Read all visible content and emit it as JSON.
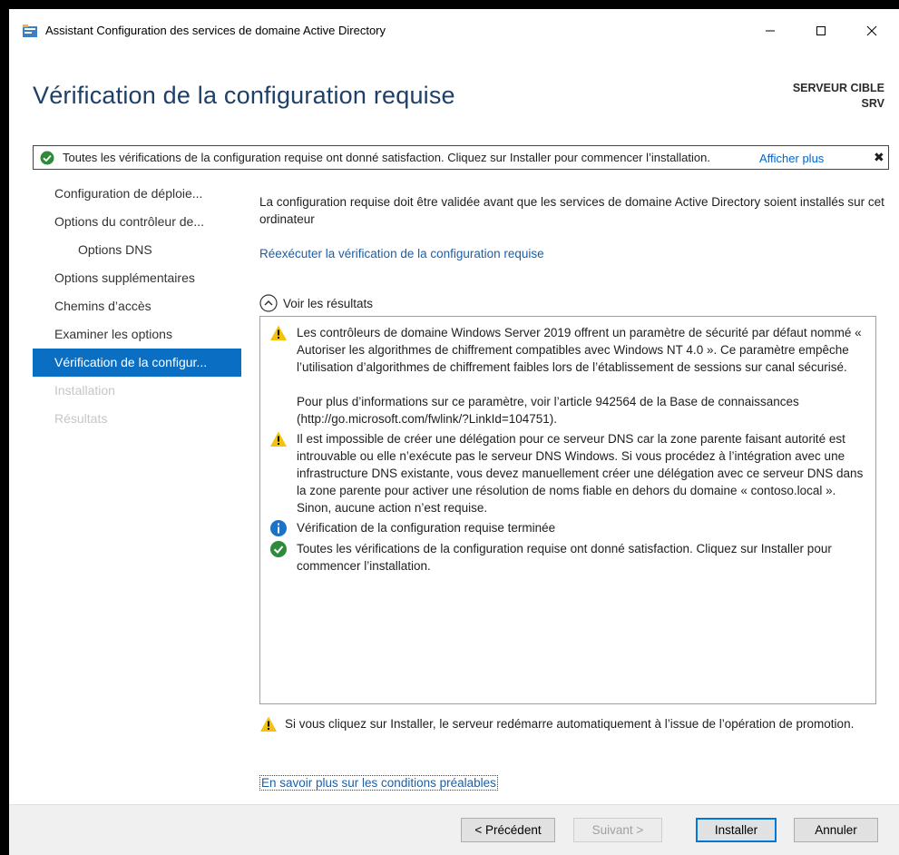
{
  "window": {
    "title": "Assistant Configuration des services de domaine Active Directory",
    "min_glyph": "—",
    "max_glyph": "☐",
    "close_glyph": "✕"
  },
  "header": {
    "page_title": "Vérification de la configuration requise",
    "target_label": "SERVEUR CIBLE",
    "target_name": "SRV"
  },
  "notification": {
    "text": "Toutes les vérifications de la configuration requise ont donné satisfaction. Cliquez sur Installer pour commencer l’installation.",
    "more_link": "Afficher plus",
    "close_glyph": "✖",
    "icon": "check-circle-icon"
  },
  "sidebar": {
    "items": [
      {
        "label": "Configuration de déploie..."
      },
      {
        "label": "Options du contrôleur de..."
      },
      {
        "label": "Options DNS"
      },
      {
        "label": "Options supplémentaires"
      },
      {
        "label": "Chemins d’accès"
      },
      {
        "label": "Examiner les options"
      },
      {
        "label": "Vérification de la configur..."
      },
      {
        "label": "Installation"
      },
      {
        "label": "Résultats"
      }
    ]
  },
  "main": {
    "intro": "La configuration requise doit être validée avant que les services de domaine Active Directory soient installés sur cet ordinateur",
    "rerun_link": "Réexécuter la vérification de la configuration requise",
    "results_toggle": "Voir les résultats",
    "results": [
      {
        "icon": "warning-icon",
        "paragraphs": [
          "Les contrôleurs de domaine Windows Server 2019 offrent un paramètre de sécurité par défaut nommé « Autoriser les algorithmes de chiffrement compatibles avec Windows NT 4.0 ». Ce paramètre empêche l’utilisation d’algorithmes de chiffrement faibles lors de l’établissement de sessions sur canal sécurisé.",
          "Pour plus d’informations sur ce paramètre, voir l’article 942564 de la Base de connaissances (http://go.microsoft.com/fwlink/?LinkId=104751)."
        ]
      },
      {
        "icon": "warning-icon",
        "paragraphs": [
          "Il est impossible de créer une délégation pour ce serveur DNS car la zone parente faisant autorité est introuvable ou elle n’exécute pas le serveur DNS Windows. Si vous procédez à l’intégration avec une infrastructure DNS existante, vous devez manuellement créer une délégation avec ce serveur DNS dans la zone parente pour activer une résolution de noms fiable en dehors du domaine « contoso.local ». Sinon, aucune action n’est requise."
        ]
      },
      {
        "icon": "info-icon",
        "paragraphs": [
          "Vérification de la configuration requise terminée"
        ]
      },
      {
        "icon": "check-circle-icon",
        "paragraphs": [
          "Toutes les vérifications de la configuration requise ont donné satisfaction. Cliquez sur Installer pour commencer l’installation."
        ]
      }
    ],
    "restart_warning": "Si vous cliquez sur Installer, le serveur redémarre automatiquement à l’issue de l’opération de promotion.",
    "learn_more_link": "En savoir plus sur les conditions préalables"
  },
  "footer": {
    "previous": "< Précédent",
    "next": "Suivant >",
    "install": "Installer",
    "cancel": "Annuler"
  },
  "colors": {
    "title_blue": "#1e3f66",
    "active_nav": "#0a6fc2",
    "link": "#1c5fa6",
    "warning": "#f4c20d",
    "info": "#1a73c8",
    "success": "#2e8b3a"
  }
}
